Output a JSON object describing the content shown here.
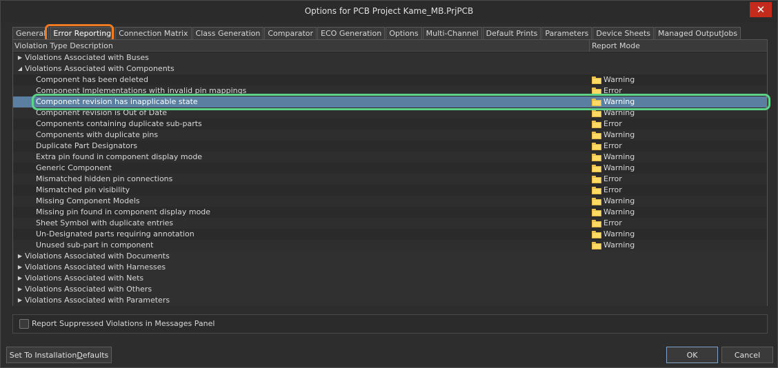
{
  "window": {
    "title": "Options for PCB Project Kame_MB.PrjPCB",
    "close_glyph": "✕"
  },
  "tabs": [
    {
      "label": "General"
    },
    {
      "label": "Error Reporting"
    },
    {
      "label": "Connection Matrix"
    },
    {
      "label": "Class Generation"
    },
    {
      "label": "Comparator"
    },
    {
      "label": "ECO Generation"
    },
    {
      "label": "Options"
    },
    {
      "label": "Multi-Channel"
    },
    {
      "label": "Default Prints"
    },
    {
      "label": "Parameters"
    },
    {
      "label": "Device Sheets"
    },
    {
      "label": "Managed OutputJobs"
    }
  ],
  "active_tab": "Error Reporting",
  "grid": {
    "columns": {
      "description": "Violation Type Description",
      "mode": "Report Mode"
    },
    "groups_before": [
      {
        "label": "Violations Associated with Buses",
        "expanded": false
      }
    ],
    "expanded_group": {
      "label": "Violations Associated with Components",
      "items": [
        {
          "label": "Component has been deleted",
          "mode": "Warning"
        },
        {
          "label": "Component Implementations with invalid pin mappings",
          "mode": "Error"
        },
        {
          "label": "Component revision has inapplicable state",
          "mode": "Warning",
          "selected": true
        },
        {
          "label": "Component revision is Out of Date",
          "mode": "Warning"
        },
        {
          "label": "Components containing duplicate sub-parts",
          "mode": "Error"
        },
        {
          "label": "Components with duplicate pins",
          "mode": "Warning"
        },
        {
          "label": "Duplicate Part Designators",
          "mode": "Error"
        },
        {
          "label": "Extra pin found in component display mode",
          "mode": "Warning"
        },
        {
          "label": "Generic Component",
          "mode": "Warning"
        },
        {
          "label": "Mismatched hidden pin connections",
          "mode": "Error"
        },
        {
          "label": "Mismatched pin visibility",
          "mode": "Error"
        },
        {
          "label": "Missing Component Models",
          "mode": "Warning"
        },
        {
          "label": "Missing pin found in component display mode",
          "mode": "Warning"
        },
        {
          "label": "Sheet Symbol with duplicate entries",
          "mode": "Error"
        },
        {
          "label": "Un-Designated parts requiring annotation",
          "mode": "Warning"
        },
        {
          "label": "Unused sub-part in component",
          "mode": "Warning"
        }
      ]
    },
    "groups_after": [
      {
        "label": "Violations Associated with Documents"
      },
      {
        "label": "Violations Associated with Harnesses"
      },
      {
        "label": "Violations Associated with Nets"
      },
      {
        "label": "Violations Associated with Others"
      },
      {
        "label": "Violations Associated with Parameters"
      }
    ]
  },
  "checkbox": {
    "label": "Report Suppressed Violations in Messages Panel",
    "checked": false
  },
  "buttons": {
    "defaults_pre": "Set To Installation ",
    "defaults_u": "D",
    "defaults_post": "efaults",
    "ok": "OK",
    "cancel": "Cancel"
  },
  "icons": {
    "collapsed": "▶",
    "expanded": "◢",
    "mode_icon": "folder-icon"
  },
  "colors": {
    "selection": "#5b7fa1",
    "tab_highlight": "#f07b23",
    "row_highlight": "#5dd48a"
  }
}
